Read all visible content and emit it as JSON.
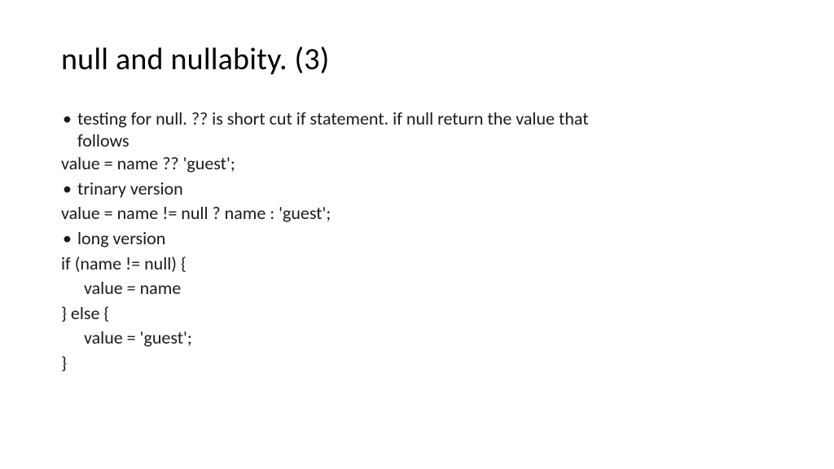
{
  "slide": {
    "title": "null and nullabity. (3)",
    "items": {
      "bullet1_line1": "testing for null.  ?? is short cut if statement.  if null return the value that",
      "bullet1_line2": "follows",
      "code1": "value = name ?? 'guest';",
      "bullet2": "trinary version",
      "code2": "value = name != null ? name : 'guest';",
      "bullet3": "long version",
      "code3_l1": "if (name != null) {",
      "code3_l2": "value = name",
      "code3_l3": "} else {",
      "code3_l4": "value = 'guest';",
      "code3_l5": "}"
    }
  }
}
